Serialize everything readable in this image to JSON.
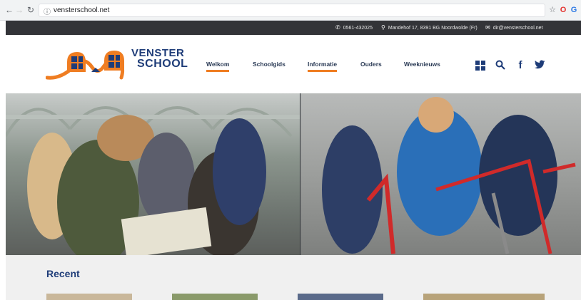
{
  "browser": {
    "url": "vensterschool.net",
    "back_icon": "arrow-left",
    "forward_icon": "arrow-right",
    "reload_icon": "reload",
    "star_icon": "star"
  },
  "topbar": {
    "phone": "0561-432025",
    "address": "Mandehof 17, 8391 BG Noordwolde (Fr)",
    "email": "dir@vensterschool.net"
  },
  "logo": {
    "line1": "VENSTER",
    "line2": "SCHOOL"
  },
  "nav": {
    "items": [
      {
        "label": "Welkom",
        "active": true
      },
      {
        "label": "Schoolgids",
        "active": false
      },
      {
        "label": "Informatie",
        "active": true
      },
      {
        "label": "Ouders",
        "active": false
      },
      {
        "label": "Weeknieuws",
        "active": false
      }
    ]
  },
  "social": {
    "facebook": "f",
    "twitter": "twitter"
  },
  "recent": {
    "title": "Recent"
  },
  "colors": {
    "accent": "#ef7d22",
    "brand": "#1e3c78",
    "topbar": "#333438"
  }
}
